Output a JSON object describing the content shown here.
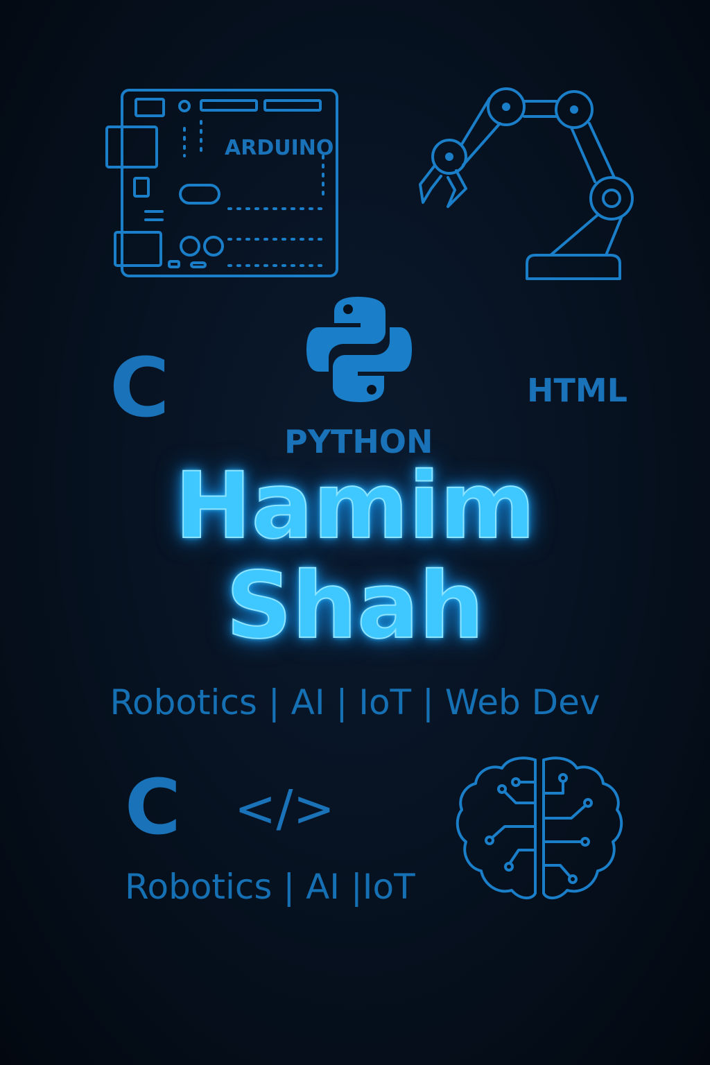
{
  "arduino": {
    "label": "ARDUINO"
  },
  "languages": {
    "c_top": "C",
    "html": "HTML",
    "python": "PYTHON",
    "c_bottom": "C",
    "code_tag": "</>"
  },
  "name": {
    "first": "Hamim",
    "last": "Shah"
  },
  "taglines": {
    "main": "Robotics | AI | IoT | Web Dev",
    "secondary": "Robotics | AI |IoT"
  },
  "colors": {
    "accent": "#3fc8ff",
    "icon": "#1a7fc8",
    "background": "#06111f"
  }
}
